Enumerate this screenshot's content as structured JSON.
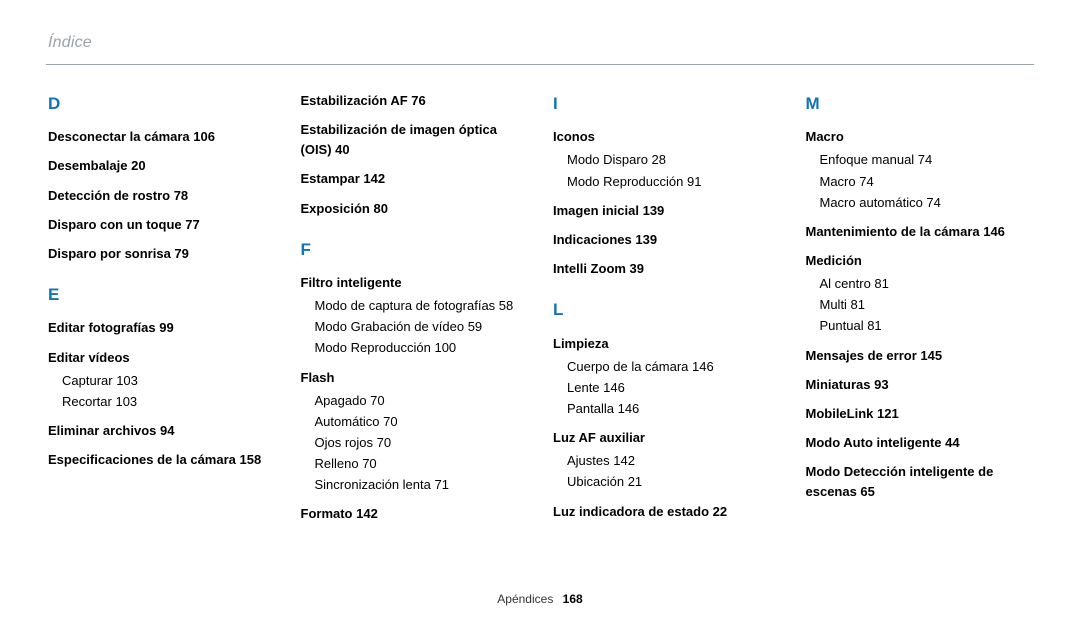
{
  "header": {
    "title": "Índice"
  },
  "footer": {
    "section": "Apéndices",
    "page": "168"
  },
  "cols": [
    {
      "letters": [
        {
          "letter": "D",
          "entries": [
            {
              "t": "Desconectar la cámara  106"
            },
            {
              "t": "Desembalaje  20"
            },
            {
              "t": "Detección de rostro  78"
            },
            {
              "t": "Disparo con un toque  77"
            },
            {
              "t": "Disparo por sonrisa  79"
            }
          ]
        },
        {
          "letter": "E",
          "entries": [
            {
              "t": "Editar fotografías  99"
            },
            {
              "t": "Editar vídeos",
              "subs": [
                "Capturar  103",
                "Recortar  103"
              ]
            },
            {
              "t": "Eliminar archivos  94"
            },
            {
              "t": "Especificaciones de la cámara  158"
            }
          ]
        }
      ]
    },
    {
      "letters": [
        {
          "letter": "",
          "entries": [
            {
              "t": "Estabilización AF  76"
            },
            {
              "t": "Estabilización de imagen óptica (OIS)  40"
            },
            {
              "t": "Estampar  142"
            },
            {
              "t": "Exposición  80"
            }
          ]
        },
        {
          "letter": "F",
          "entries": [
            {
              "t": "Filtro inteligente",
              "subs": [
                "Modo de captura de fotografías  58",
                "Modo Grabación de vídeo  59",
                "Modo Reproducción  100"
              ]
            },
            {
              "t": "Flash",
              "subs": [
                "Apagado  70",
                "Automático  70",
                "Ojos rojos  70",
                "Relleno  70",
                "Sincronización lenta  71"
              ]
            },
            {
              "t": "Formato  142"
            }
          ]
        }
      ]
    },
    {
      "letters": [
        {
          "letter": "I",
          "entries": [
            {
              "t": "Iconos",
              "subs": [
                "Modo Disparo  28",
                "Modo Reproducción  91"
              ]
            },
            {
              "t": "Imagen inicial  139"
            },
            {
              "t": "Indicaciones  139"
            },
            {
              "t": "Intelli Zoom  39"
            }
          ]
        },
        {
          "letter": "L",
          "entries": [
            {
              "t": "Limpieza",
              "subs": [
                "Cuerpo de la cámara  146",
                "Lente  146",
                "Pantalla  146"
              ]
            },
            {
              "t": "Luz AF auxiliar",
              "subs": [
                "Ajustes  142",
                "Ubicación  21"
              ]
            },
            {
              "t": "Luz indicadora de estado  22"
            }
          ]
        }
      ]
    },
    {
      "letters": [
        {
          "letter": "M",
          "entries": [
            {
              "t": "Macro",
              "subs": [
                "Enfoque manual  74",
                "Macro  74",
                "Macro automático  74"
              ]
            },
            {
              "t": "Mantenimiento de la cámara  146"
            },
            {
              "t": "Medición",
              "subs": [
                "Al centro  81",
                "Multi  81",
                "Puntual  81"
              ]
            },
            {
              "t": "Mensajes de error  145"
            },
            {
              "t": "Miniaturas  93"
            },
            {
              "t": "MobileLink  121"
            },
            {
              "t": "Modo Auto inteligente  44"
            },
            {
              "t": "Modo Detección inteligente de escenas  65"
            }
          ]
        }
      ]
    }
  ]
}
